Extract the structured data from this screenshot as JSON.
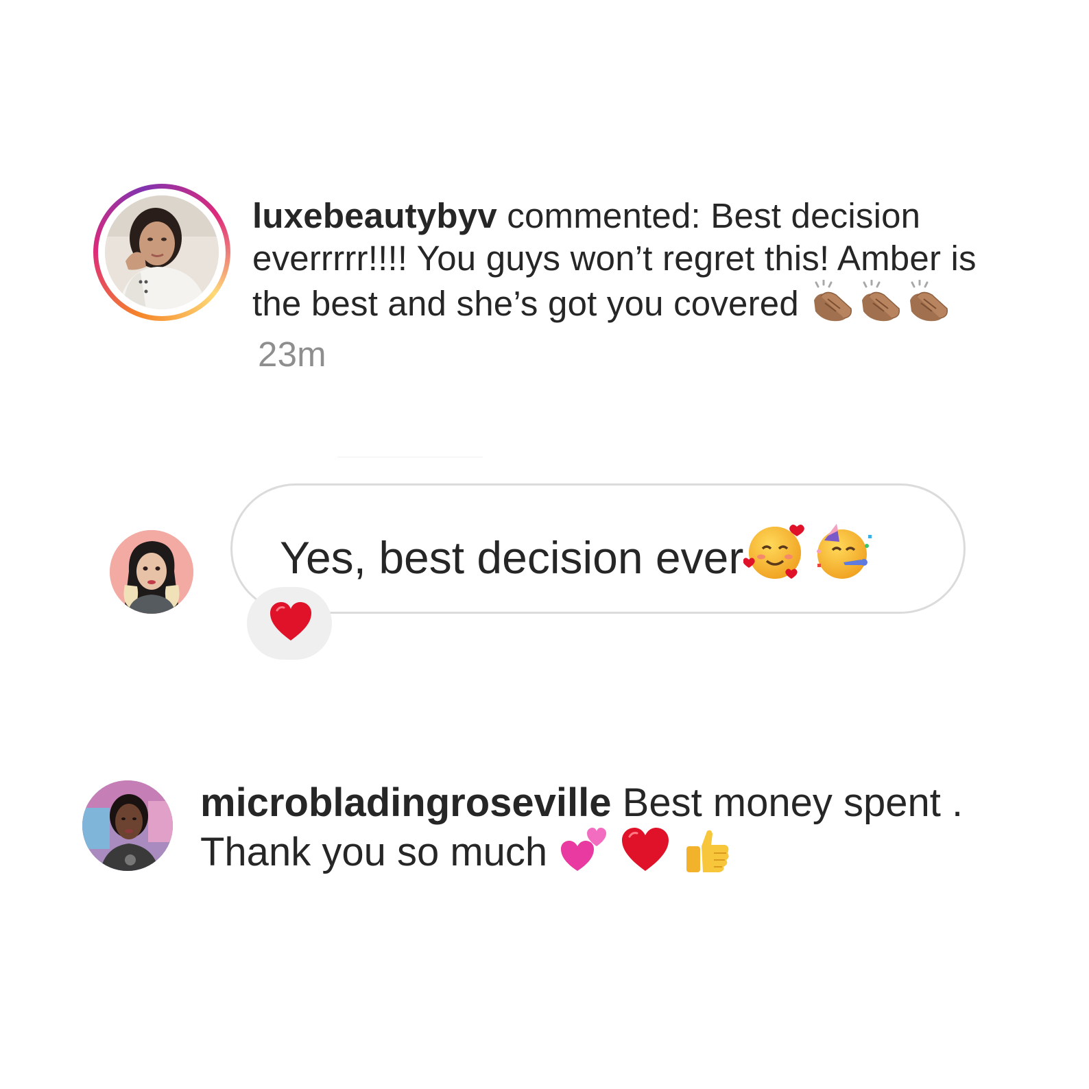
{
  "comment_notification": {
    "username": "luxebeautybyv",
    "action": "commented:",
    "text": "Best decision everrrrr!!!! You guys won’t regret this! Amber is the best and she’s got you covered",
    "emojis": [
      "clapping-hands-icon",
      "clapping-hands-icon",
      "clapping-hands-icon"
    ],
    "time": "23m",
    "ring_colors": [
      "#f58529",
      "#dd2a7b",
      "#8134af",
      "#feda77"
    ]
  },
  "reply": {
    "text": "Yes, best decision ever",
    "emojis": [
      "smiling-face-with-hearts-icon",
      "partying-face-icon"
    ],
    "reaction": "red-heart-icon",
    "bubble_border": "#dbdbdb",
    "reaction_bg": "#efefef"
  },
  "comment": {
    "username": "microbladingroseville",
    "text_line1": " Best money spent .",
    "text_line2": "Thank you so much",
    "emojis": [
      "two-hearts-icon",
      "red-heart-icon",
      "thumbs-up-icon"
    ]
  },
  "colors": {
    "text": "#262626",
    "muted": "#8e8e8e",
    "heart": "#e0122a"
  }
}
